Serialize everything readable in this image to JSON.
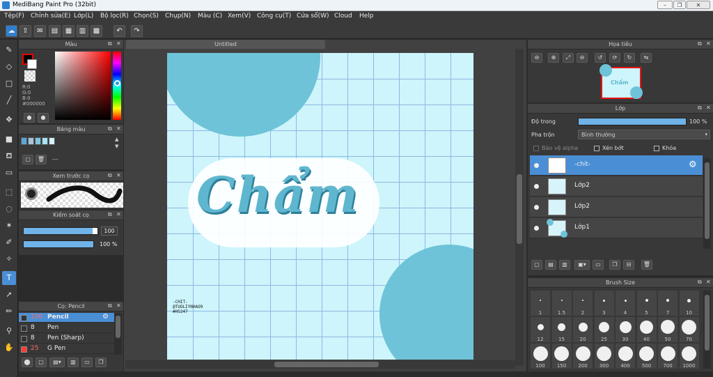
{
  "window": {
    "title": "MediBang Paint Pro (32bit)"
  },
  "menu": [
    "Tệp(F)",
    "Chỉnh sửa(E)",
    "Lớp(L)",
    "Bộ lọc(R)",
    "Chọn(S)",
    "Chụp(N)",
    "Màu (C)",
    "Xem(V)",
    "Công cụ(T)",
    "Cửa sổ(W)",
    "Cloud",
    "Help"
  ],
  "document": {
    "tab": "Untitled",
    "watermark": [
      "-CHIT-",
      "@TUOLIYNHAO9",
      "#HS247"
    ],
    "lettering": "Chẩm"
  },
  "color_panel": {
    "title": "Màu",
    "r": "R:0",
    "g": "G:0",
    "b": "B:0",
    "hex": "#000000",
    "primary_color": "#000000",
    "secondary_color": "#ffffff"
  },
  "palette_panel": {
    "title": "Bảng màu",
    "swatches": [
      "#5aa7d8",
      "#a7c4d8",
      "#7fc4e0",
      "#a9e4f5",
      "#d2f3fb"
    ],
    "name": "---"
  },
  "brush_preview": {
    "title": "Xem trước cọ"
  },
  "brush_control": {
    "title": "Kiểm soát cọ",
    "size": "100",
    "opacity": "100 %",
    "size_level": 0.93,
    "opacity_level": 1.0
  },
  "brush_list": {
    "title": "Cọ: Pencil",
    "items": [
      {
        "size": "100",
        "name": "Pencil",
        "color": "#ff3b3b",
        "selected": true
      },
      {
        "size": "8",
        "name": "Pen",
        "color": "#333333"
      },
      {
        "size": "8",
        "name": "Pen (Sharp)",
        "color": "#333333"
      },
      {
        "size": "25",
        "name": "G Pen",
        "color": "#ff3b3b"
      }
    ]
  },
  "navigator": {
    "title": "Họa tiêu"
  },
  "layer_panel": {
    "title": "Lớp",
    "opacity_label": "Độ trong",
    "opacity_value": "100 %",
    "opacity_level": 1.0,
    "blend_label": "Pha trộn",
    "blend_value": "Bình thường",
    "protect_alpha": "Bảo vệ alpha",
    "clipping": "Xén bớt",
    "lock": "Khóa",
    "layers": [
      {
        "name": "-chit-",
        "selected": true
      },
      {
        "name": "Lớp2"
      },
      {
        "name": "Lớp2"
      },
      {
        "name": "Lớp1"
      }
    ]
  },
  "brush_size_panel": {
    "title": "Brush Size",
    "sizes": [
      "1",
      "1.5",
      "2",
      "3",
      "4",
      "5",
      "7",
      "10",
      "12",
      "15",
      "20",
      "25",
      "30",
      "40",
      "50",
      "70",
      "100",
      "150",
      "200",
      "300",
      "400",
      "500",
      "700",
      "1000"
    ]
  }
}
